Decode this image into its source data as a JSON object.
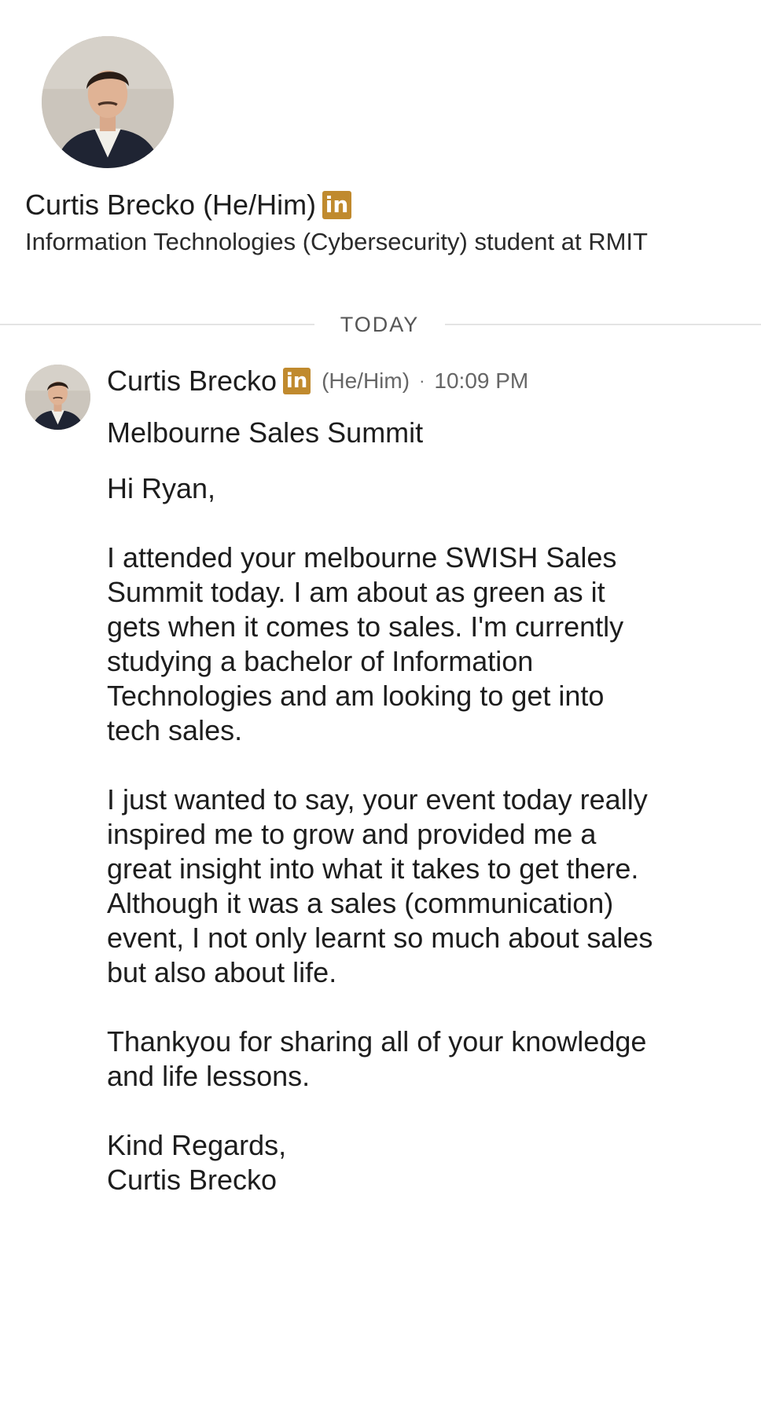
{
  "profile": {
    "name": "Curtis Brecko",
    "pronouns": "(He/Him)",
    "badge": "in",
    "headline": "Information Technologies (Cybersecurity) student at RMIT"
  },
  "divider": {
    "label": "TODAY"
  },
  "message": {
    "sender": "Curtis Brecko",
    "badge": "in",
    "pronouns": "(He/Him)",
    "dot": "·",
    "time": "10:09 PM",
    "subject": "Melbourne Sales Summit",
    "lines": [
      "Hi Ryan,",
      "",
      "I attended your melbourne SWISH Sales",
      "Summit today. I am about as green as it",
      "gets when it comes to sales. I'm currently",
      "studying a bachelor of Information",
      "Technologies and am looking to get into",
      "tech sales.",
      "",
      "I just wanted to say, your event today really",
      "inspired me to grow and provided me a",
      "great insight into what it takes to get there.",
      "Although it was a sales (communication)",
      "event, I not only learnt so much about sales",
      "but also about life.",
      "",
      "Thankyou for sharing all of your knowledge",
      "and life lessons.",
      "",
      "Kind Regards,",
      "Curtis Brecko"
    ]
  },
  "colors": {
    "badge": "#c08a2e",
    "divider": "#e4e4e4",
    "muted_text": "#666666",
    "body_text": "#1d1d1d"
  }
}
